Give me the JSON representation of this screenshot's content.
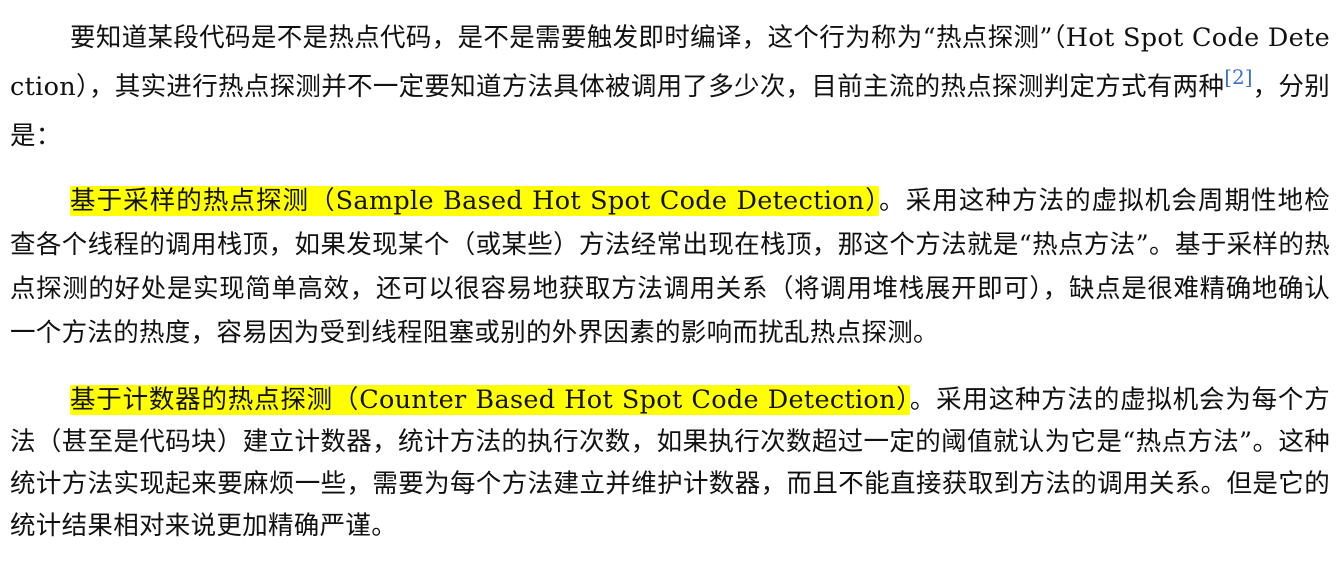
{
  "paragraphs": [
    {
      "before_cite": "要知道某段代码是不是热点代码，是不是需要触发即时编译，这个行为称为“热点探测”（Hot Spot Code Detection），其实进行热点探测并不一定要知道方法具体被调用了多少次，目前主流的热点探测判定方式有两种",
      "cite": "[2]",
      "after_cite": "，分别是："
    },
    {
      "highlight": "基于采样的热点探测（Sample Based Hot Spot Code Detection）",
      "body": "。采用这种方法的虚拟机会周期性地检查各个线程的调用栈顶，如果发现某个（或某些）方法经常出现在栈顶，那这个方法就是“热点方法”。基于采样的热点探测的好处是实现简单高效，还可以很容易地获取方法调用关系（将调用堆栈展开即可），缺点是很难精确地确认一个方法的热度，容易因为受到线程阻塞或别的外界因素的影响而扰乱热点探测。"
    },
    {
      "highlight": "基于计数器的热点探测（Counter Based Hot Spot Code Detection）",
      "body": "。采用这种方法的虚拟机会为每个方法（甚至是代码块）建立计数器，统计方法的执行次数，如果执行次数超过一定的阈值就认为它是“热点方法”。这种统计方法实现起来要麻烦一些，需要为每个方法建立并维护计数器，而且不能直接获取到方法的调用关系。但是它的统计结果相对来说更加精确严谨。"
    }
  ],
  "colors": {
    "highlight": "#ffff00",
    "citation": "#3a6fd1",
    "text": "#111111"
  }
}
